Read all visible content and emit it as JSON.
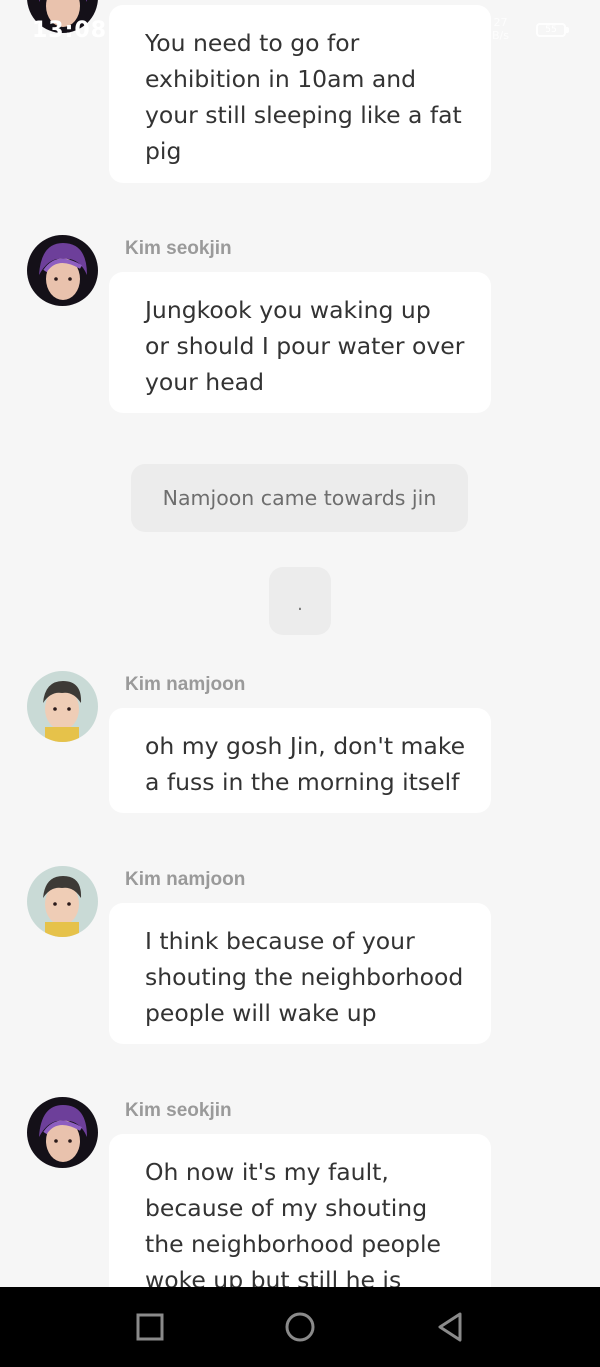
{
  "status_bar": {
    "time": "13:08",
    "net_speed_value": "27",
    "net_speed_unit": "B/s",
    "battery": "55"
  },
  "chat": {
    "messages": [
      {
        "sender": "",
        "lines": [
          "You need to go for",
          "exhibition in 10am and",
          "your still sleeping like a fat",
          "pig"
        ]
      },
      {
        "sender": "Kim seokjin",
        "lines": [
          "Jungkook you waking up",
          "or should I pour water over",
          "your head"
        ]
      },
      {
        "sender": "Kim namjoon",
        "lines": [
          "oh my gosh Jin, don't make",
          "a fuss in the morning itself"
        ]
      },
      {
        "sender": "Kim namjoon",
        "lines": [
          "I think because of your",
          "shouting the neighborhood",
          "people will wake up"
        ]
      },
      {
        "sender": "Kim seokjin",
        "lines": [
          "Oh now it's my fault,",
          "because of my shouting",
          "the neighborhood people",
          "woke up but still he is"
        ]
      }
    ],
    "narration": "Namjoon came towards jin",
    "pause": "."
  },
  "nav": {
    "recent_icon": "square-icon",
    "home_icon": "circle-icon",
    "back_icon": "triangle-back-icon"
  },
  "colors": {
    "background": "#f6f6f6",
    "bubble": "#ffffff",
    "narration_bubble": "#ececec",
    "sender_name": "#9a9a9a",
    "text": "#333333",
    "nav_bar": "#000000"
  }
}
